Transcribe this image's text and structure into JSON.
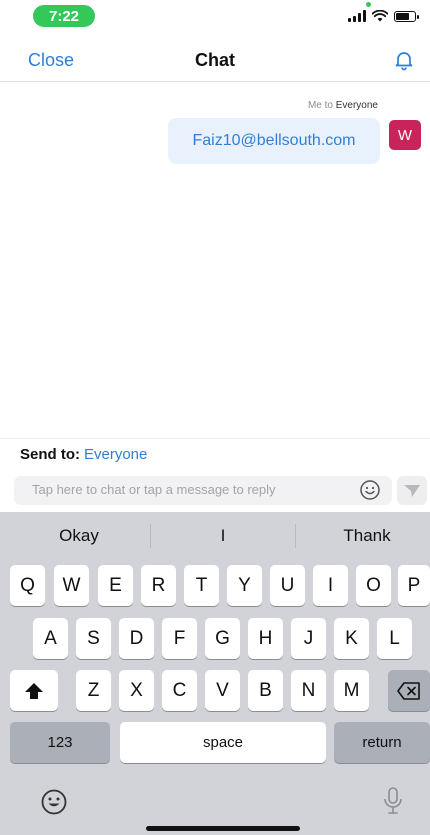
{
  "status_bar": {
    "time": "7:22"
  },
  "nav": {
    "close_label": "Close",
    "title": "Chat",
    "bell_icon": "bell-icon"
  },
  "message": {
    "meta_prefix": "Me to",
    "meta_target": "Everyone",
    "text": "Faiz10@bellsouth.com",
    "avatar_initial": "W",
    "avatar_color": "#c8245a"
  },
  "composer": {
    "send_to_label": "Send to:",
    "send_to_target": "Everyone",
    "placeholder": "Tap here to chat or tap a message to reply",
    "emoji_icon": "smiley-icon",
    "send_icon": "send-arrow-icon"
  },
  "keyboard": {
    "suggestions": [
      "Okay",
      "I",
      "Thank"
    ],
    "row1": [
      "Q",
      "W",
      "E",
      "R",
      "T",
      "Y",
      "U",
      "I",
      "O",
      "P"
    ],
    "row2": [
      "A",
      "S",
      "D",
      "F",
      "G",
      "H",
      "J",
      "K",
      "L"
    ],
    "row3": [
      "Z",
      "X",
      "C",
      "V",
      "B",
      "N",
      "M"
    ],
    "numbers_label": "123",
    "space_label": "space",
    "return_label": "return",
    "shift_icon": "shift-icon",
    "delete_icon": "delete-icon",
    "emoji_icon": "emoji-icon",
    "mic_icon": "microphone-icon"
  },
  "colors": {
    "accent": "#2f7fd6",
    "status_green": "#34c759",
    "keyboard_bg": "#d1d3d9"
  }
}
